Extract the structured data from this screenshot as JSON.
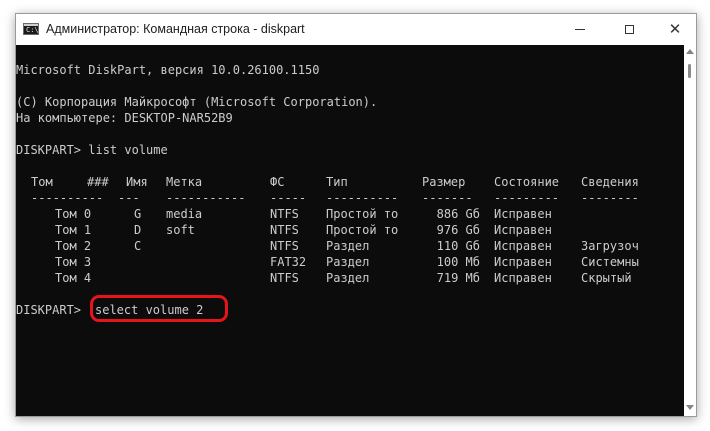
{
  "window": {
    "title": "Администратор: Командная строка - diskpart",
    "icon": "cmd-icon",
    "icon_glyph": "C:\\"
  },
  "console": {
    "version_line": "Microsoft DiskPart, версия 10.0.26100.1150",
    "copyright_line": "(C) Корпорация Майкрософт (Microsoft Corporation).",
    "computer_line": "На компьютере: DESKTOP-NAR52B9",
    "command1": "DISKPART> list volume",
    "table": {
      "headers": [
        "Том",
        "###",
        "Имя",
        "Метка",
        "ФС",
        "Тип",
        "Размер",
        "Состояние",
        "Сведения"
      ],
      "separators": [
        "----------",
        "---",
        "-----------",
        "-----",
        "----------",
        "-------",
        "---------",
        "--------"
      ],
      "rows": [
        {
          "vol": "Том 0",
          "letter": "G",
          "label": "media",
          "fs": "NTFS",
          "type": "Простой то",
          "size": "886 Gб",
          "status": "Исправен",
          "info": ""
        },
        {
          "vol": "Том 1",
          "letter": "D",
          "label": "soft",
          "fs": "NTFS",
          "type": "Простой то",
          "size": "976 Gб",
          "status": "Исправен",
          "info": ""
        },
        {
          "vol": "Том 2",
          "letter": "C",
          "label": "",
          "fs": "NTFS",
          "type": "Раздел",
          "size": "110 Gб",
          "status": "Исправен",
          "info": "Загрузоч"
        },
        {
          "vol": "Том 3",
          "letter": "",
          "label": "",
          "fs": "FAT32",
          "type": "Раздел",
          "size": "100 Mб",
          "status": "Исправен",
          "info": "Системны"
        },
        {
          "vol": "Том 4",
          "letter": "",
          "label": "",
          "fs": "NTFS",
          "type": "Раздел",
          "size": "719 Mб",
          "status": "Исправен",
          "info": "Скрытый"
        }
      ]
    },
    "prompt2": "DISKPART> ",
    "command2": "select volume 2"
  },
  "colors": {
    "console_bg": "#0c0c0c",
    "console_text": "#cccccc",
    "highlight": "#e8141c"
  }
}
